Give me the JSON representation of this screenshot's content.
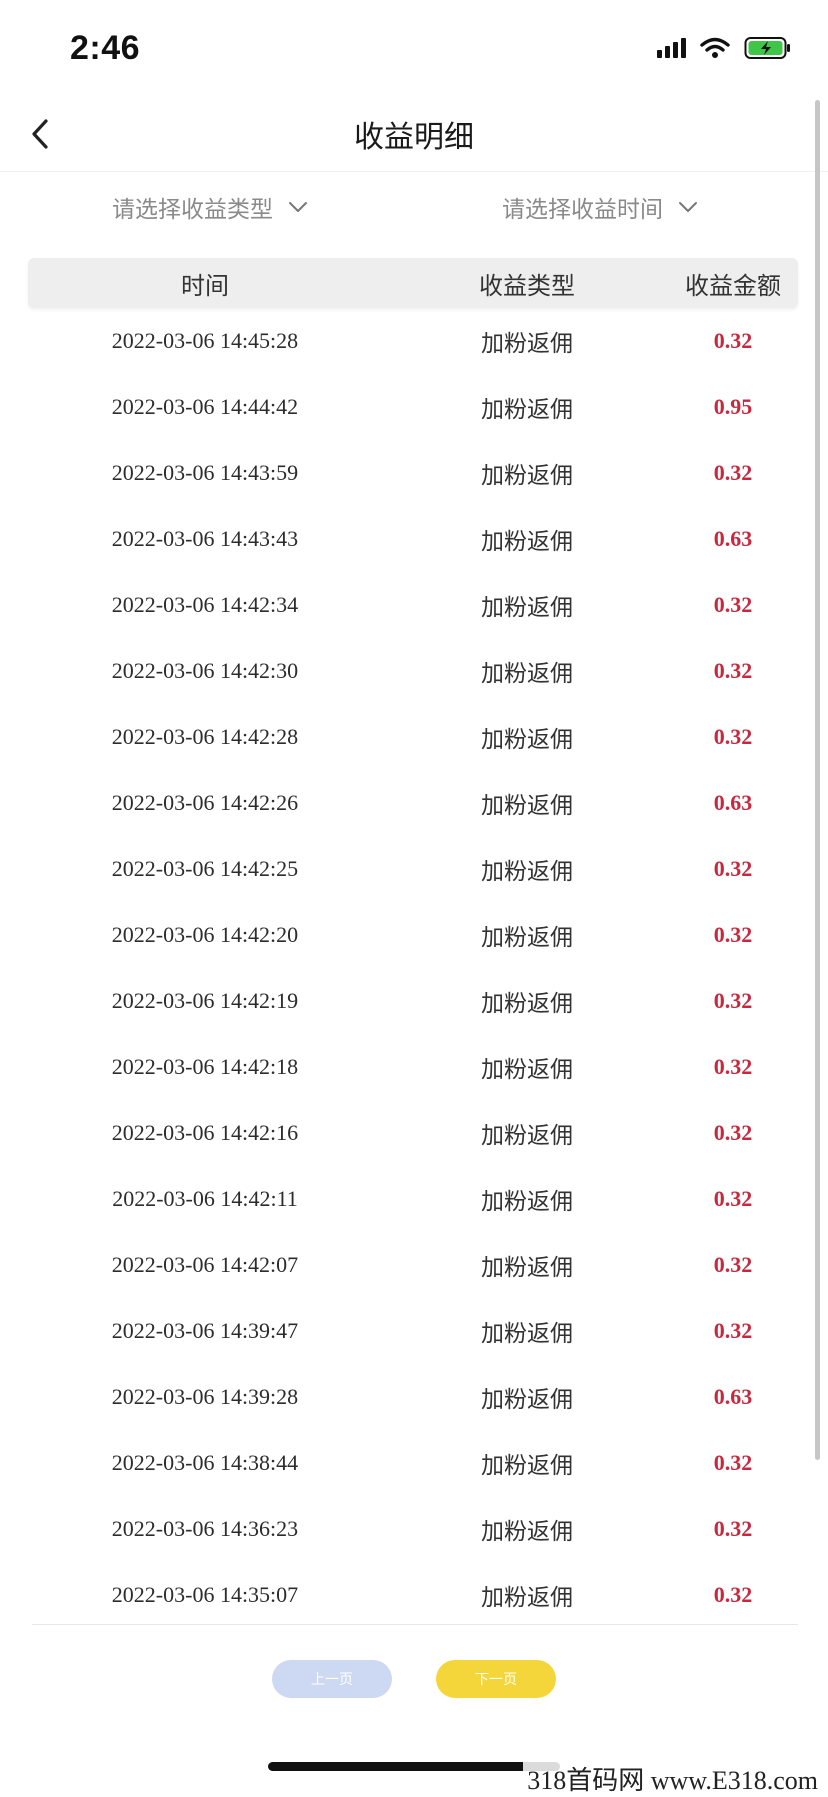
{
  "status_bar": {
    "time": "2:46",
    "icons": [
      "signal-icon",
      "wifi-icon",
      "battery-charging-icon"
    ]
  },
  "nav": {
    "title": "收益明细",
    "back_icon": "chevron-left-icon"
  },
  "filters": {
    "type_placeholder": "请选择收益类型",
    "time_placeholder": "请选择收益时间",
    "dropdown_icon": "chevron-down-icon"
  },
  "table": {
    "headers": [
      "时间",
      "收益类型",
      "收益金额"
    ],
    "rows": [
      {
        "time": "2022-03-06 14:45:28",
        "type": "加粉返佣",
        "amount": "0.32"
      },
      {
        "time": "2022-03-06 14:44:42",
        "type": "加粉返佣",
        "amount": "0.95"
      },
      {
        "time": "2022-03-06 14:43:59",
        "type": "加粉返佣",
        "amount": "0.32"
      },
      {
        "time": "2022-03-06 14:43:43",
        "type": "加粉返佣",
        "amount": "0.63"
      },
      {
        "time": "2022-03-06 14:42:34",
        "type": "加粉返佣",
        "amount": "0.32"
      },
      {
        "time": "2022-03-06 14:42:30",
        "type": "加粉返佣",
        "amount": "0.32"
      },
      {
        "time": "2022-03-06 14:42:28",
        "type": "加粉返佣",
        "amount": "0.32"
      },
      {
        "time": "2022-03-06 14:42:26",
        "type": "加粉返佣",
        "amount": "0.63"
      },
      {
        "time": "2022-03-06 14:42:25",
        "type": "加粉返佣",
        "amount": "0.32"
      },
      {
        "time": "2022-03-06 14:42:20",
        "type": "加粉返佣",
        "amount": "0.32"
      },
      {
        "time": "2022-03-06 14:42:19",
        "type": "加粉返佣",
        "amount": "0.32"
      },
      {
        "time": "2022-03-06 14:42:18",
        "type": "加粉返佣",
        "amount": "0.32"
      },
      {
        "time": "2022-03-06 14:42:16",
        "type": "加粉返佣",
        "amount": "0.32"
      },
      {
        "time": "2022-03-06 14:42:11",
        "type": "加粉返佣",
        "amount": "0.32"
      },
      {
        "time": "2022-03-06 14:42:07",
        "type": "加粉返佣",
        "amount": "0.32"
      },
      {
        "time": "2022-03-06 14:39:47",
        "type": "加粉返佣",
        "amount": "0.32"
      },
      {
        "time": "2022-03-06 14:39:28",
        "type": "加粉返佣",
        "amount": "0.63"
      },
      {
        "time": "2022-03-06 14:38:44",
        "type": "加粉返佣",
        "amount": "0.32"
      },
      {
        "time": "2022-03-06 14:36:23",
        "type": "加粉返佣",
        "amount": "0.32"
      },
      {
        "time": "2022-03-06 14:35:07",
        "type": "加粉返佣",
        "amount": "0.32"
      }
    ]
  },
  "pagination": {
    "prev_label": "上一页",
    "next_label": "下一页"
  },
  "watermark": "318首码网 www.E318.com",
  "colors": {
    "amount": "#c8283e",
    "header_bg": "#eeeeee",
    "prev_button": "#cdd8f2",
    "next_button": "#f5d63a"
  }
}
